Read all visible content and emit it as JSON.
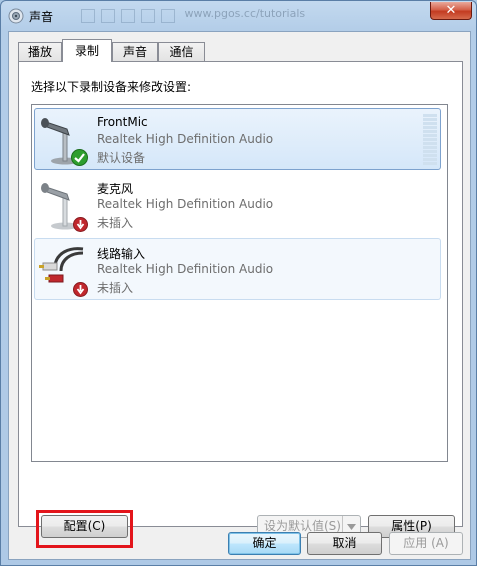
{
  "window": {
    "title": "声音",
    "close_label": "✕",
    "ghost_text": "www.pgos.cc/tutorials"
  },
  "tabs": [
    {
      "label": "播放"
    },
    {
      "label": "录制",
      "active": true
    },
    {
      "label": "声音"
    },
    {
      "label": "通信"
    }
  ],
  "prompt": "选择以下录制设备来修改设置:",
  "devices": [
    {
      "name": "FrontMic",
      "driver": "Realtek High Definition Audio",
      "status": "默认设备",
      "icon": "microphone-icon",
      "badge": "green-check-badge-icon",
      "selected": true
    },
    {
      "name": "麦克风",
      "driver": "Realtek High Definition Audio",
      "status": "未插入",
      "icon": "microphone-icon",
      "badge": "red-unplugged-badge-icon",
      "selected": false
    },
    {
      "name": "线路输入",
      "driver": "Realtek High Definition Audio",
      "status": "未插入",
      "icon": "rca-cable-icon",
      "badge": "red-unplugged-badge-icon",
      "selected": false
    }
  ],
  "buttons": {
    "configure": "配置(C)",
    "set_default": "设为默认值(S)",
    "properties": "属性(P)",
    "ok": "确定",
    "cancel": "取消",
    "apply": "应用 (A)"
  },
  "colors": {
    "highlight": "#e3151b",
    "selection": "#d5e7f9",
    "status_ok": "#2e9e2e",
    "status_unplugged": "#c0272d"
  }
}
